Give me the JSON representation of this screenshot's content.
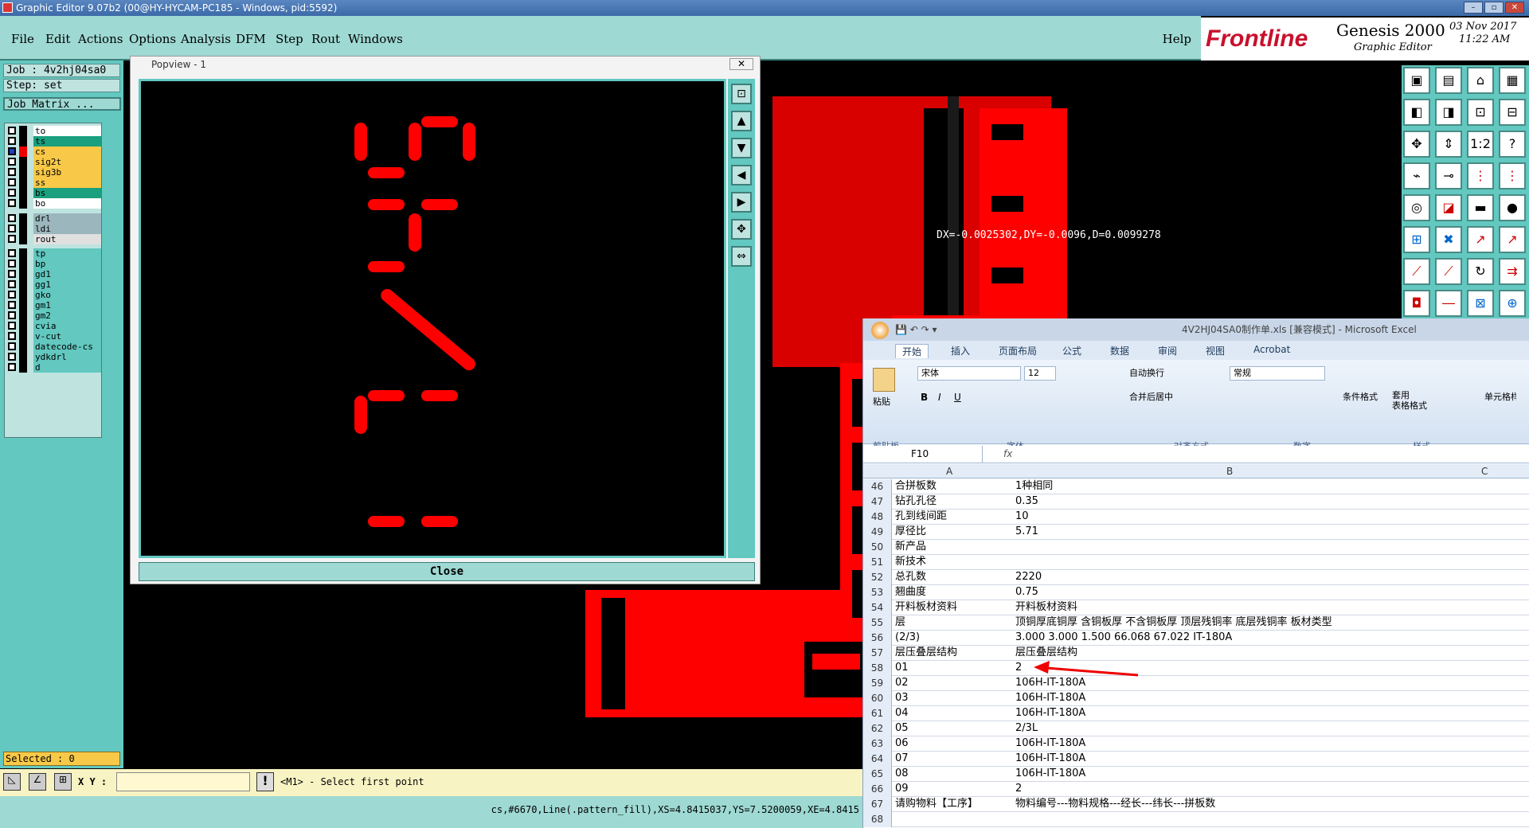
{
  "window": {
    "title": "Graphic Editor 9.07b2 (00@HY-HYCAM-PC185 - Windows, pid:5592)"
  },
  "menu": {
    "items": [
      "File",
      "Edit",
      "Actions",
      "Options",
      "Analysis",
      "DFM",
      "Step",
      "Rout",
      "Windows"
    ],
    "help": "Help"
  },
  "brand": {
    "logo": "Frontline",
    "product": "Genesis 2000",
    "sub": "Graphic Editor",
    "date": "03 Nov 2017",
    "time": "11:22 AM"
  },
  "job": {
    "job_label": "Job : 4v2hj04sa0",
    "step_label": "Step: set",
    "matrix_btn": "Job Matrix ..."
  },
  "layers": [
    {
      "name": "to",
      "color": "#ffffff"
    },
    {
      "name": "ts",
      "color": "#1aa07e"
    },
    {
      "name": "cs",
      "color": "#f8c948",
      "active": true
    },
    {
      "name": "sig2t",
      "color": "#f8c948"
    },
    {
      "name": "sig3b",
      "color": "#f8c948"
    },
    {
      "name": "ss",
      "color": "#f8c948"
    },
    {
      "name": "bs",
      "color": "#1aa07e"
    },
    {
      "name": "bo",
      "color": "#ffffff"
    },
    {
      "name": "drl",
      "color": "#9bb7bd"
    },
    {
      "name": "ldi",
      "color": "#9bb7bd"
    },
    {
      "name": "rout",
      "color": "#e0e0e0"
    },
    {
      "name": "tp",
      "color": "#62c8c0"
    },
    {
      "name": "bp",
      "color": "#62c8c0"
    },
    {
      "name": "gd1",
      "color": "#62c8c0"
    },
    {
      "name": "gg1",
      "color": "#62c8c0"
    },
    {
      "name": "gko",
      "color": "#62c8c0"
    },
    {
      "name": "gm1",
      "color": "#62c8c0"
    },
    {
      "name": "gm2",
      "color": "#62c8c0"
    },
    {
      "name": "cvia",
      "color": "#62c8c0"
    },
    {
      "name": "v-cut",
      "color": "#62c8c0"
    },
    {
      "name": "datecode-cs",
      "color": "#62c8c0"
    },
    {
      "name": "ydkdrl",
      "color": "#62c8c0"
    },
    {
      "name": "d",
      "color": "#62c8c0"
    }
  ],
  "selected": "Selected : 0",
  "popview": {
    "title": "Popview - 1",
    "close_label": "Close"
  },
  "coord_readout": "DX=-0.0025302,DY=-0.0096,D=0.0099278",
  "bottom": {
    "xy_label": "X Y :",
    "prompt": "<M1> - Select first point",
    "status": "cs,#6670,Line(.pattern_fill),XS=4.8415037,YS=7.5200059,XE=4.8415"
  },
  "excel": {
    "title": "4V2HJ04SA0制作单.xls [兼容模式] - Microsoft Excel",
    "tabs": [
      "开始",
      "插入",
      "页面布局",
      "公式",
      "数据",
      "审阅",
      "视图",
      "Acrobat"
    ],
    "font_name": "宋体",
    "font_size": "12",
    "number_format": "常规",
    "wrap": "自动换行",
    "merge": "合并后居中",
    "groups": [
      "剪贴板",
      "字体",
      "对齐方式",
      "数字",
      "样式"
    ],
    "paste": "粘贴",
    "cond": "条件格式",
    "table": "套用\n表格格式",
    "cellstyle": "单元格样式",
    "cell_ref": "F10",
    "fx": "fx",
    "cols": [
      "A",
      "B",
      "C"
    ],
    "rows": [
      {
        "n": "46",
        "a": "合拼板数",
        "b": "1种相同"
      },
      {
        "n": "47",
        "a": "钻孔孔径",
        "b": "0.35"
      },
      {
        "n": "48",
        "a": "孔到线间距",
        "b": "10"
      },
      {
        "n": "49",
        "a": "厚径比",
        "b": "5.71"
      },
      {
        "n": "50",
        "a": "新产品",
        "b": ""
      },
      {
        "n": "51",
        "a": "新技术",
        "b": ""
      },
      {
        "n": "52",
        "a": "总孔数",
        "b": "2220"
      },
      {
        "n": "53",
        "a": "翘曲度",
        "b": "0.75"
      },
      {
        "n": "54",
        "a": "开料板材资料",
        "b": "开料板材资料"
      },
      {
        "n": "55",
        "a": "层",
        "b": "顶铜厚底铜厚 含铜板厚 不含铜板厚 顶层残铜率 底层残铜率 板材类型"
      },
      {
        "n": "56",
        "a": "(2/3)",
        "b": "3.000  3.000   1.500             66.068    67.022       IT-180A"
      },
      {
        "n": "57",
        "a": "层压叠层结构",
        "b": "层压叠层结构"
      },
      {
        "n": "58",
        "a": "01",
        "b": "2"
      },
      {
        "n": "59",
        "a": "02",
        "b": "106H-IT-180A"
      },
      {
        "n": "60",
        "a": "03",
        "b": "106H-IT-180A"
      },
      {
        "n": "61",
        "a": "04",
        "b": "106H-IT-180A"
      },
      {
        "n": "62",
        "a": "05",
        "b": "2/3L"
      },
      {
        "n": "63",
        "a": "06",
        "b": "106H-IT-180A"
      },
      {
        "n": "64",
        "a": "07",
        "b": "106H-IT-180A"
      },
      {
        "n": "65",
        "a": "08",
        "b": "106H-IT-180A"
      },
      {
        "n": "66",
        "a": "09",
        "b": "2"
      },
      {
        "n": "67",
        "a": "请购物料【工序】",
        "b": "物料编号---物料规格---经长---纬长---拼板数"
      },
      {
        "n": "68",
        "a": "",
        "b": ""
      }
    ]
  },
  "colors": {
    "accent": "#62c8c0",
    "menu_bg": "#9ed9d3",
    "pcb_red": "#ff0000"
  }
}
